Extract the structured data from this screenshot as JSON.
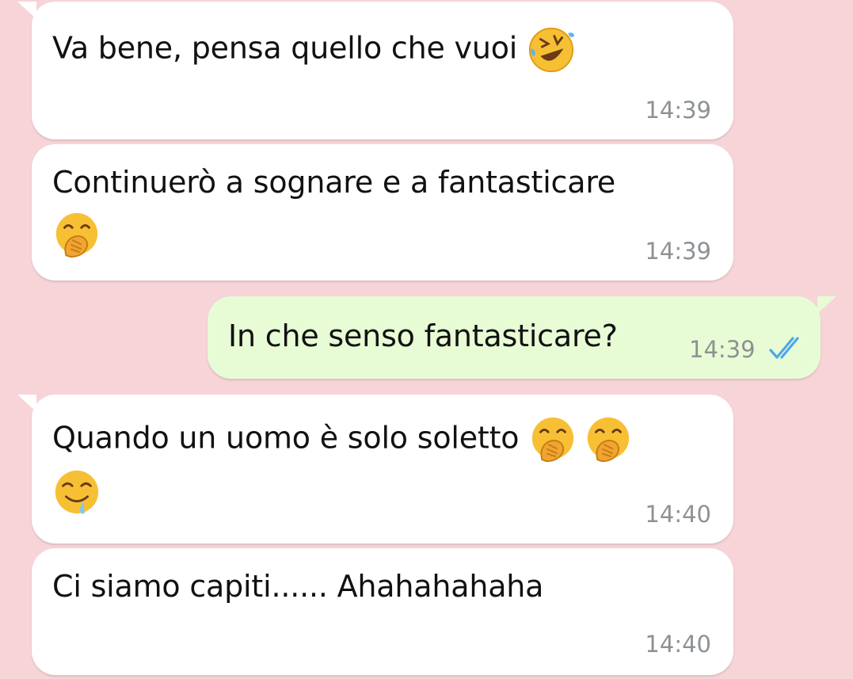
{
  "conversation": {
    "messages": [
      {
        "direction": "incoming",
        "text": "Va bene, pensa quello che vuoi",
        "emojis": [
          "rolling-on-floor-laughing-emoji"
        ],
        "time": "14:39"
      },
      {
        "direction": "incoming",
        "text": "Continuerò a sognare e a fantasticare",
        "emojis": [
          "hand-over-mouth-emoji"
        ],
        "time": "14:39"
      },
      {
        "direction": "outgoing",
        "text": "In che senso fantasticare?",
        "time": "14:39",
        "status": "read"
      },
      {
        "direction": "incoming",
        "text": "Quando un uomo è solo soletto",
        "emojis": [
          "hand-over-mouth-emoji",
          "hand-over-mouth-emoji",
          "drooling-face-emoji"
        ],
        "time": "14:40"
      },
      {
        "direction": "incoming",
        "text": "Ci siamo capiti...... Ahahahahaha",
        "time": "14:40"
      }
    ]
  },
  "colors": {
    "background": "#f6d4d8",
    "incoming_bubble": "#ffffff",
    "outgoing_bubble": "#e7fcd5",
    "timestamp": "#8d9194",
    "read_ticks": "#4fa8e8"
  }
}
